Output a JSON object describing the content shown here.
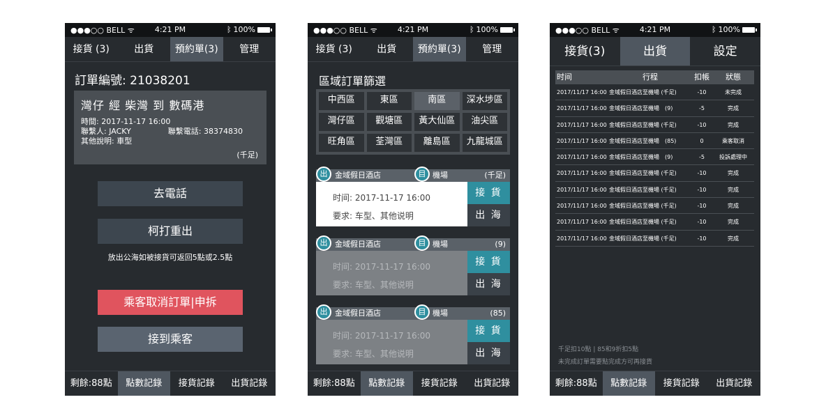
{
  "status": {
    "carrier": "●●●○○ BELL",
    "wifi": "ᯤ",
    "time": "4:21 PM",
    "bt": "ᛒ",
    "battery": "100%"
  },
  "nav": {
    "tabs": [
      "接貨 (3)",
      "出貨",
      "預約單(3)",
      "管理"
    ],
    "tabs3": [
      "接貨(3)",
      "出貨",
      "設定"
    ]
  },
  "bottom": {
    "remain": "剩餘:88點",
    "points": "點數記錄",
    "pickup": "接貨記錄",
    "ship": "出貨記錄"
  },
  "screen1": {
    "order_no": "訂單編號: 21038201",
    "route": "灣仔 經 柴灣 到 數碼港",
    "time": "時間: 2017-11-17 16:00",
    "contact": "聯繫人: JACKY",
    "phone": "聯繫電話: 38374830",
    "other": "其他說明: 車型",
    "tag": "(千足)",
    "call": "去電話",
    "redial": "柯打重出",
    "hint": "放出公海如被接貨可返回5點或2.5點",
    "cancel": "乘客取消訂單|申拆",
    "picked": "接到乘客"
  },
  "screen2": {
    "filter_title": "區域訂單篩選",
    "areas": [
      "中西區",
      "東區",
      "南區",
      "深水埗區",
      "灣仔區",
      "觀塘區",
      "黃大仙區",
      "油尖區",
      "旺角區",
      "荃灣區",
      "離島區",
      "九龍城區"
    ],
    "from_icon": "出",
    "to_icon": "目",
    "orders": [
      {
        "from": "金域假日酒店",
        "to": "機場",
        "tag": "(千足)",
        "time": "时间: 2017-11-17 16:00",
        "req": "要求: 车型、其他说明"
      },
      {
        "from": "金域假日酒店",
        "to": "機場",
        "tag": "(9)",
        "time": "时间: 2017-11-17 16:00",
        "req": "要求: 车型、其他说明"
      },
      {
        "from": "金域假日酒店",
        "to": "機場",
        "tag": "(85)",
        "time": "时间: 2017-11-17 16:00",
        "req": "要求: 车型、其他说明"
      }
    ],
    "accept": "接 貨",
    "out": "出 海"
  },
  "screen3": {
    "headers": {
      "time": "时间",
      "trip": "行程",
      "ded": "扣帳",
      "status": "狀態"
    },
    "rows": [
      {
        "time": "2017/11/17 16:00",
        "trip": "金域假日酒店至機場 (千足)",
        "ded": "-10",
        "status": "未完成"
      },
      {
        "time": "2017/11/17 16:00",
        "trip": "金域假日酒店至機場　(9)",
        "ded": "-5",
        "status": "完成"
      },
      {
        "time": "2017/11/17 16:00",
        "trip": "金域假日酒店至機場 (千足)",
        "ded": "-10",
        "status": "完成"
      },
      {
        "time": "2017/11/17 16:00",
        "trip": "金域假日酒店至機場　(85)",
        "ded": "0",
        "status": "乘客取消"
      },
      {
        "time": "2017/11/17 16:00",
        "trip": "金域假日酒店至機場　(9)",
        "ded": "-5",
        "status": "投訴處理中"
      },
      {
        "time": "2017/11/17 16:00",
        "trip": "金域假日酒店至機場 (千足)",
        "ded": "-10",
        "status": "完成"
      },
      {
        "time": "2017/11/17 16:00",
        "trip": "金域假日酒店至機場 (千足)",
        "ded": "-10",
        "status": "完成"
      },
      {
        "time": "2017/11/17 16:00",
        "trip": "金域假日酒店至機場 (千足)",
        "ded": "-10",
        "status": "完成"
      },
      {
        "time": "2017/11/17 16:00",
        "trip": "金域假日酒店至機場 (千足)",
        "ded": "-10",
        "status": "完成"
      },
      {
        "time": "2017/11/17 16:00",
        "trip": "金域假日酒店至機場 (千足)",
        "ded": "-10",
        "status": "完成"
      }
    ],
    "foot1": "千足扣10點 | 85和9折扣5點",
    "foot2": "未完成訂單需要點完成方可再接貨"
  },
  "colors": {
    "bg": "#272b2f",
    "accent": "#2f8f9f",
    "danger": "#e0545e",
    "active_tab": "#4f5760"
  }
}
